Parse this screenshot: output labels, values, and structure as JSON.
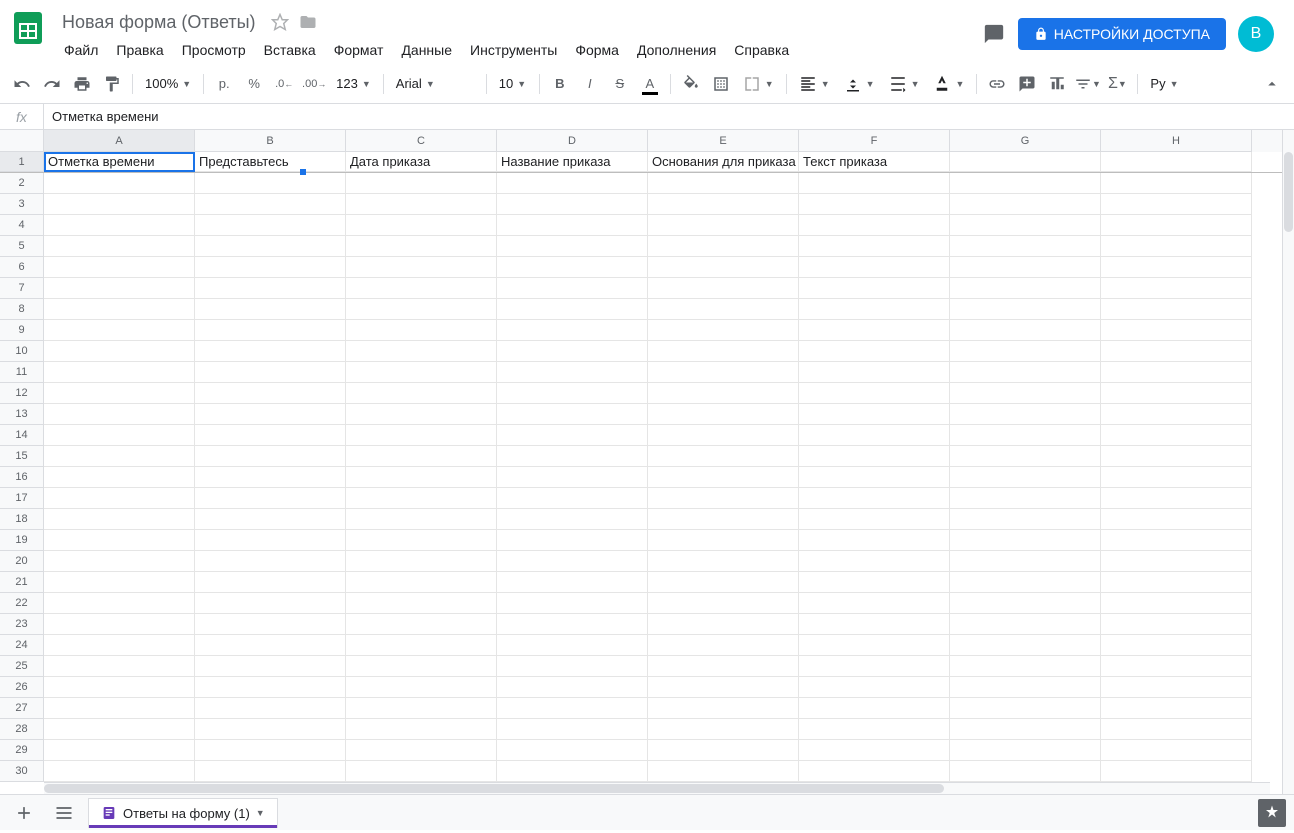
{
  "header": {
    "doc_title": "Новая форма (Ответы)",
    "share_label": "НАСТРОЙКИ ДОСТУПА",
    "avatar_letter": "B"
  },
  "menu": {
    "items": [
      "Файл",
      "Правка",
      "Просмотр",
      "Вставка",
      "Формат",
      "Данные",
      "Инструменты",
      "Форма",
      "Дополнения",
      "Справка"
    ]
  },
  "toolbar": {
    "zoom": "100%",
    "currency": "р.",
    "percent": "%",
    "dec_less": ".0",
    "dec_more": ".00",
    "format_123": "123",
    "font": "Arial",
    "font_size": "10",
    "input_lang": "Ру"
  },
  "formula": {
    "fx": "fx",
    "value": "Отметка времени"
  },
  "grid": {
    "columns": [
      "A",
      "B",
      "C",
      "D",
      "E",
      "F",
      "G",
      "H"
    ],
    "row_count": 30,
    "selected_cell": {
      "row": 1,
      "col": 0
    },
    "data": {
      "1": [
        "Отметка времени",
        "Представьтесь",
        "Дата приказа",
        "Название приказа",
        "Основания для приказа",
        "Текст приказа",
        "",
        ""
      ]
    }
  },
  "bottom": {
    "sheet_name": "Ответы на форму (1)"
  }
}
